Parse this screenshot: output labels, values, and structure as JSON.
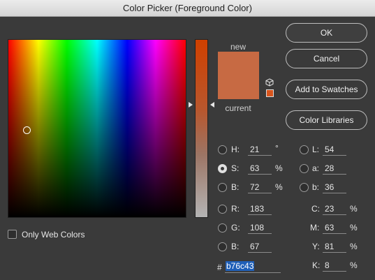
{
  "window": {
    "title": "Color Picker (Foreground Color)"
  },
  "swatches": {
    "new_label": "new",
    "current_label": "current",
    "new_color": "#c76a43",
    "current_color": "#c76a43",
    "gamut_color": "#d8541c"
  },
  "buttons": {
    "ok": "OK",
    "cancel": "Cancel",
    "add_to_swatches": "Add to Swatches",
    "color_libraries": "Color Libraries"
  },
  "only_web_colors": {
    "label": "Only Web Colors",
    "checked": false
  },
  "fields": {
    "H": {
      "label": "H:",
      "value": "21",
      "unit": "°",
      "selected": false
    },
    "S": {
      "label": "S:",
      "value": "63",
      "unit": "%",
      "selected": true
    },
    "Bv": {
      "label": "B:",
      "value": "72",
      "unit": "%",
      "selected": false
    },
    "R": {
      "label": "R:",
      "value": "183",
      "selected": false
    },
    "G": {
      "label": "G:",
      "value": "108",
      "selected": false
    },
    "B": {
      "label": "B:",
      "value": "67",
      "selected": false
    },
    "L": {
      "label": "L:",
      "value": "54",
      "selected": false
    },
    "a": {
      "label": "a:",
      "value": "28",
      "selected": false
    },
    "b": {
      "label": "b:",
      "value": "36",
      "selected": false
    },
    "C": {
      "label": "C:",
      "value": "23",
      "unit": "%"
    },
    "M": {
      "label": "M:",
      "value": "63",
      "unit": "%"
    },
    "Y": {
      "label": "Y:",
      "value": "81",
      "unit": "%"
    },
    "K": {
      "label": "K:",
      "value": "8",
      "unit": "%"
    }
  },
  "hex": {
    "label": "#",
    "value": "b76c43"
  }
}
